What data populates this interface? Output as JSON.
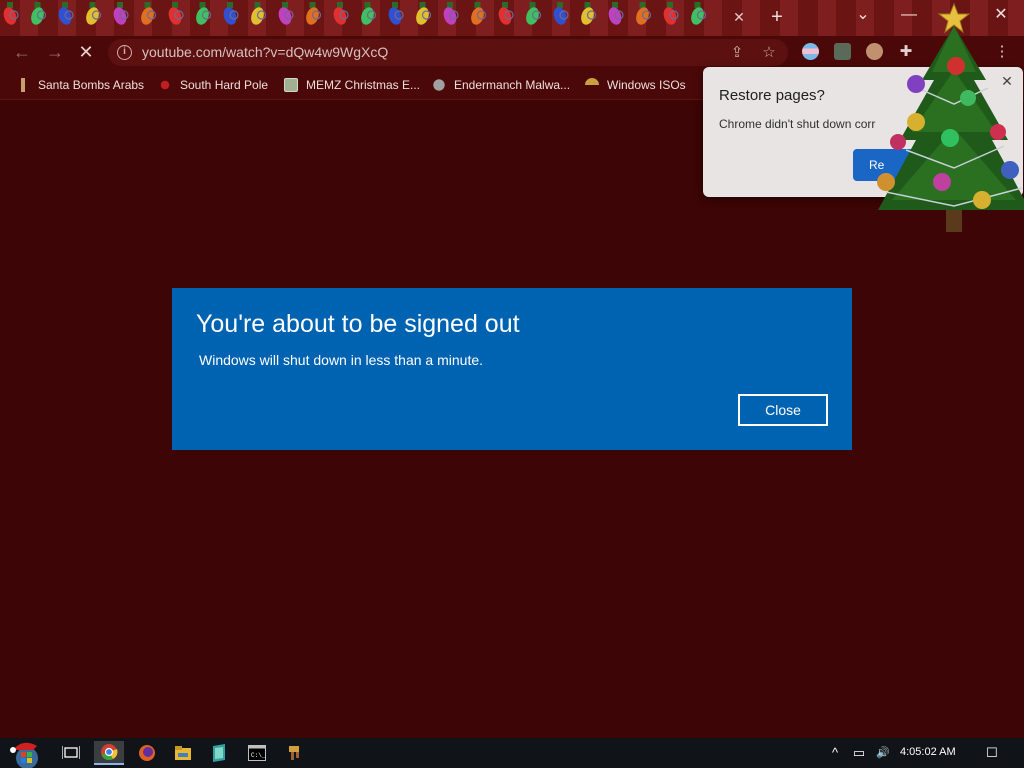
{
  "browser": {
    "url": "youtube.com/watch?v=dQw4w9WgXcQ",
    "tab_close_glyph": "✕",
    "new_tab_glyph": "+",
    "window_controls": {
      "chevron": "⌄",
      "minimize": "—",
      "maximize": "☐",
      "close": "✕"
    },
    "nav": {
      "back": "←",
      "forward": "→",
      "stop": "✕"
    },
    "icons": {
      "info": "i",
      "share": "⇪",
      "star": "☆",
      "puzzle": "✚",
      "menu": "⋮"
    }
  },
  "bookmarks": [
    {
      "label": "Santa Bombs Arabs",
      "icon": "candle-icon",
      "color": "#c8a070"
    },
    {
      "label": "South Hard Pole",
      "icon": "virus-icon",
      "color": "#c02020"
    },
    {
      "label": "MEMZ Christmas E...",
      "icon": "image-icon",
      "color": "#a0b090"
    },
    {
      "label": "Endermanch Malwa...",
      "icon": "raccoon-icon",
      "color": "#a0a0a0"
    },
    {
      "label": "Windows ISOs",
      "icon": "lamp-icon",
      "color": "#c8a040"
    }
  ],
  "restore_popup": {
    "title": "Restore pages?",
    "message": "Chrome didn't shut down corr",
    "button_label": "Re",
    "close_glyph": "✕"
  },
  "signout_dialog": {
    "title": "You're about to be signed out",
    "message": "Windows will shut down in less than a minute.",
    "close_label": "Close",
    "bg_color": "#0063b1"
  },
  "taskbar": {
    "clock": "4:05:02 AM",
    "tray": {
      "chevron": "^",
      "network": "▭",
      "volume": "🔊",
      "notifications": "☐"
    }
  },
  "colors": {
    "page_bg": "#3d0505",
    "toolbar_bg": "#4a0808",
    "accent_blue": "#1a66c4"
  }
}
